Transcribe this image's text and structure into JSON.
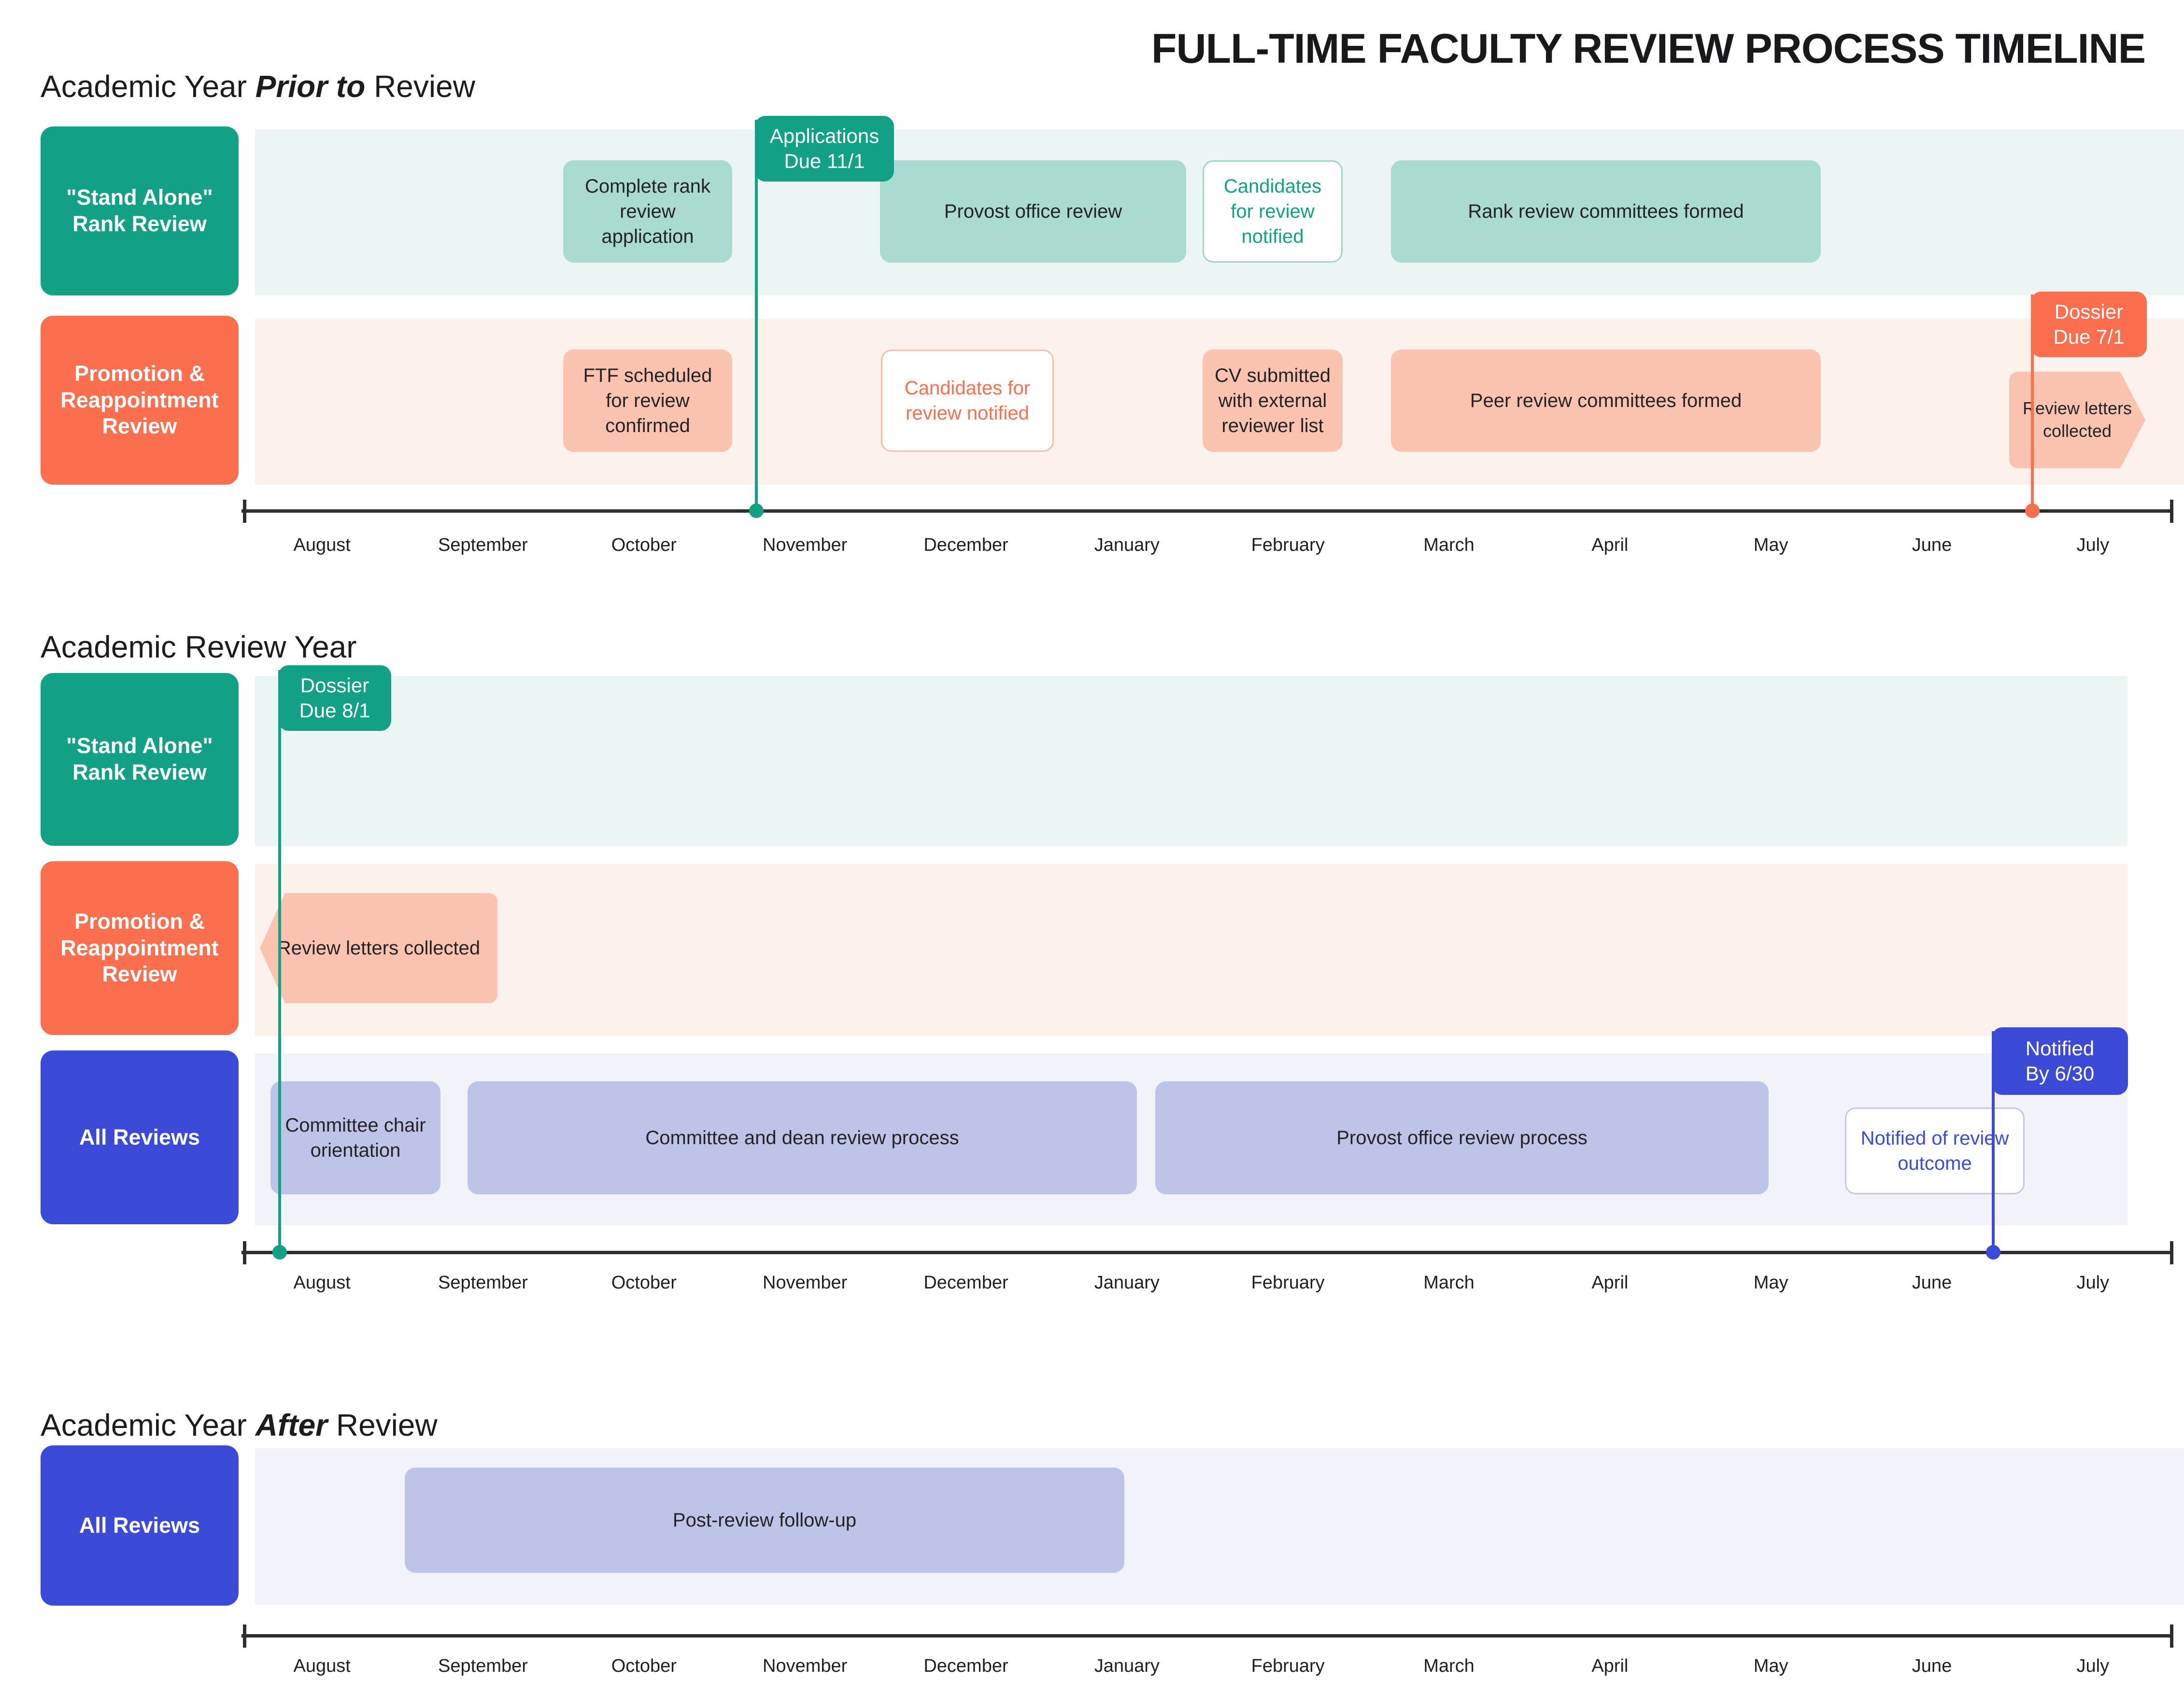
{
  "title": "FULL-TIME FACULTY REVIEW PROCESS TIMELINE",
  "months": [
    "August",
    "September",
    "October",
    "November",
    "December",
    "January",
    "February",
    "March",
    "April",
    "May",
    "June",
    "July"
  ],
  "sections": [
    {
      "id": "prior",
      "heading_pre": "Academic Year ",
      "heading_em": "Prior to",
      "heading_post": " Review",
      "lanes": [
        {
          "label": "\"Stand Alone\"\nRank Review",
          "label_line1": "\"Stand Alone\"",
          "label_line2": "Rank Review",
          "color": "green",
          "tasks": [
            {
              "text": "Complete rank review application",
              "style": "g-fill"
            },
            {
              "text": "Provost office review",
              "style": "g-fill"
            },
            {
              "text": "Candidates for review notified",
              "style": "g-out"
            },
            {
              "text": "Rank review committees formed",
              "style": "g-fill"
            }
          ],
          "milestones": [
            {
              "line1": "Applications",
              "line2": "Due 11/1",
              "color": "green"
            }
          ]
        },
        {
          "label_line1": "Promotion &",
          "label_line2": "Reappointment",
          "label_line3": "Review",
          "color": "orange",
          "tasks": [
            {
              "text": "FTF scheduled for review confirmed",
              "style": "o-fill"
            },
            {
              "text": "Candidates for review notified",
              "style": "o-out"
            },
            {
              "text": "CV submitted with external reviewer list",
              "style": "o-fill"
            },
            {
              "text": "Peer review committees formed",
              "style": "o-fill"
            },
            {
              "text": "Review letters collected",
              "style": "o-fill arrow-right"
            }
          ],
          "milestones": [
            {
              "line1": "Dossier",
              "line2": "Due 7/1",
              "color": "orange"
            }
          ]
        }
      ]
    },
    {
      "id": "review",
      "heading_pre": "Academic Review Year",
      "heading_em": "",
      "heading_post": "",
      "lanes": [
        {
          "label_line1": "\"Stand Alone\"",
          "label_line2": "Rank Review",
          "color": "green",
          "tasks": [],
          "milestones": [
            {
              "line1": "Dossier",
              "line2": "Due 8/1",
              "color": "green"
            }
          ]
        },
        {
          "label_line1": "Promotion &",
          "label_line2": "Reappointment",
          "label_line3": "Review",
          "color": "orange",
          "tasks": [
            {
              "text": "Review letters collected",
              "style": "o-fill arrow-left"
            }
          ],
          "milestones": []
        },
        {
          "label_line1": "All Reviews",
          "color": "blue",
          "tasks": [
            {
              "text": "Committee chair orientation",
              "style": "b-fill"
            },
            {
              "text": "Committee and dean review process",
              "style": "b-fill"
            },
            {
              "text": "Provost office review process",
              "style": "b-fill"
            },
            {
              "text": "Notified of review outcome",
              "style": "b-out"
            }
          ],
          "milestones": [
            {
              "line1": "Notified",
              "line2": "By 6/30",
              "color": "blue"
            }
          ]
        }
      ]
    },
    {
      "id": "after",
      "heading_pre": "Academic Year ",
      "heading_em": "After",
      "heading_post": " Review",
      "lanes": [
        {
          "label_line1": "All Reviews",
          "color": "blue",
          "tasks": [
            {
              "text": "Post-review follow-up",
              "style": "b-fill"
            }
          ],
          "milestones": []
        }
      ]
    }
  ],
  "colors": {
    "green": "#13a185",
    "orange": "#fb6e4e",
    "blue": "#3b4bd8",
    "green_band": "#ebf6f4",
    "orange_band": "#fdf1ec",
    "blue_band": "#f2f2fa",
    "green_task": "#aadbd0",
    "orange_task": "#f9c3b0",
    "blue_task": "#bec3e8",
    "axis": "#2e2e30"
  }
}
